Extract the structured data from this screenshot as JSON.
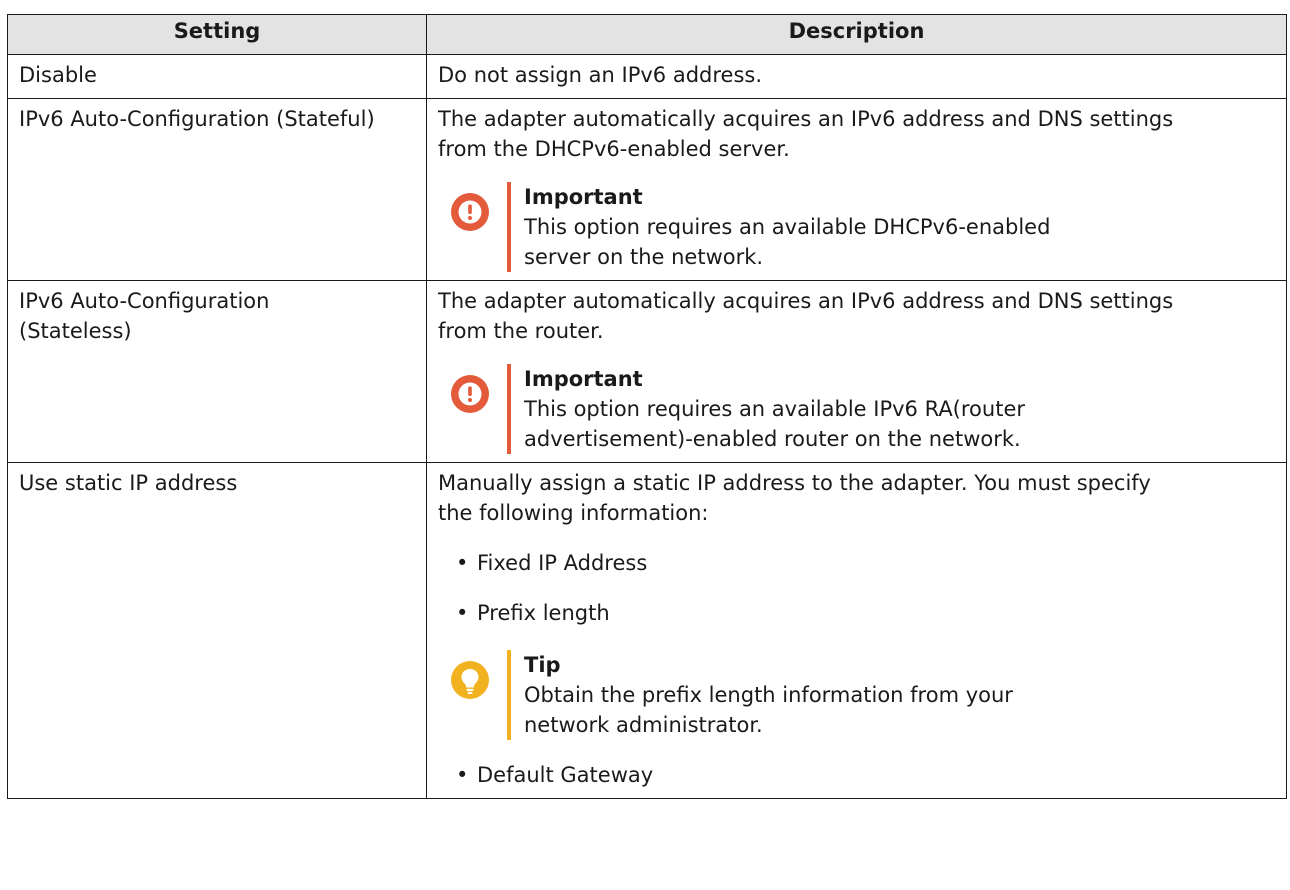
{
  "headers": {
    "setting": "Setting",
    "description": "Description"
  },
  "rows": [
    {
      "setting": "Disable",
      "description": "Do not assign an IPv6 address."
    },
    {
      "setting": "IPv6 Auto-Configuration (Stateful)",
      "description_line1": "The adapter automatically acquires an IPv6 address and DNS settings",
      "description_line2": "from the DHCPv6-enabled server.",
      "note": {
        "type": "important",
        "icon": "exclamation-icon",
        "title": "Important",
        "line1": "This option requires an available DHCPv6-enabled",
        "line2": "server on the network."
      }
    },
    {
      "setting_line1": "IPv6 Auto-Configuration",
      "setting_line2": "(Stateless)",
      "description_line1": "The adapter automatically acquires an IPv6 address and DNS settings",
      "description_line2": "from the router.",
      "note": {
        "type": "important",
        "icon": "exclamation-icon",
        "title": "Important",
        "line1": "This option requires an available IPv6 RA(router",
        "line2": "advertisement)-enabled router on the network."
      }
    },
    {
      "setting": "Use static IP address",
      "description_line1": "Manually assign a static IP address to the adapter. You must specify",
      "description_line2": "the following information:",
      "bullets": [
        "Fixed IP Address",
        "Prefix length",
        "Default Gateway"
      ],
      "bullet_char": "•",
      "tip": {
        "type": "tip",
        "icon": "lightbulb-icon",
        "title": "Tip",
        "line1": "Obtain the prefix length information from your",
        "line2": "network administrator."
      }
    }
  ],
  "colors": {
    "header_bg": "#e3e3e3",
    "important": "#e35b3a",
    "important_dark": "#b8391d",
    "tip": "#f2b21f",
    "tip_dark": "#c98a0a"
  }
}
